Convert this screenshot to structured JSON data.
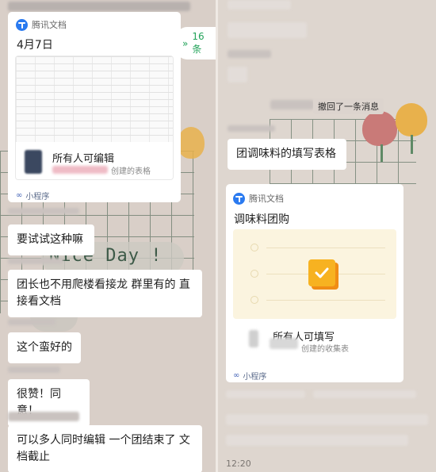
{
  "left": {
    "doc_card": {
      "app_name": "腾讯文档",
      "title": "4月7日",
      "permission": "所有人可编辑",
      "created_suffix": "创建的表格",
      "mini_program_label": "小程序"
    },
    "unread_pill": {
      "icon": "double-chevron-up-icon",
      "label": "16条"
    },
    "decor_text": "Nice Day !",
    "messages": [
      "要试试这种嘛",
      "团长也不用爬楼看接龙 群里有的 直接看文档",
      "这个蛮好的",
      "很赞！同意！",
      "可以多人同时编辑 一个团结束了 文档截止"
    ]
  },
  "right": {
    "recall_notice": "撤回了一条消息",
    "message": "团调味料的填写表格",
    "form_card": {
      "app_name": "腾讯文档",
      "title": "调味料团购",
      "permission": "所有人可填写",
      "created_suffix": "创建的收集表",
      "mini_program_label": "小程序"
    },
    "bottom_time": "12:20"
  },
  "colors": {
    "brand_blue": "#2a7af0",
    "unread_green": "#23a35a",
    "form_yellow": "#f7b221",
    "grid_green": "#3d5a48"
  }
}
